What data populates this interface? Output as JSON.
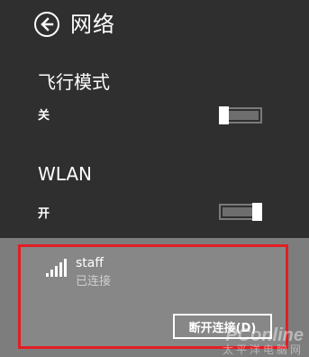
{
  "header": {
    "title": "网络",
    "back_icon": "back-arrow-icon"
  },
  "airplane_mode": {
    "title": "飞行模式",
    "state_label": "关",
    "is_on": false
  },
  "wlan": {
    "title": "WLAN",
    "state_label": "开",
    "is_on": true
  },
  "network": {
    "name": "staff",
    "status": "已连接",
    "disconnect_label": "断开连接(D)",
    "signal_icon": "wifi-signal-icon",
    "signal_bars": 5
  },
  "watermark": {
    "main": "PConline",
    "sub": "太平洋电脑网"
  },
  "colors": {
    "background": "#2f2f2f",
    "network_panel": "#7d7d7d",
    "highlight_border": "#e21e24",
    "text": "#ffffff"
  }
}
